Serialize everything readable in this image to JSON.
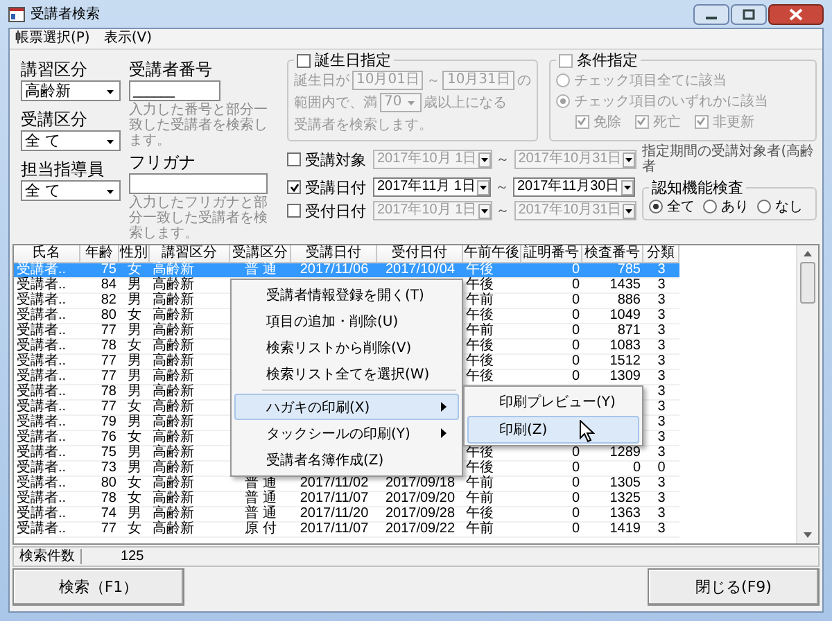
{
  "window": {
    "title": "受講者検索"
  },
  "menu": [
    "帳票選択(P)",
    "表示(V)"
  ],
  "selects": [
    {
      "label": "講習区分",
      "value": "高齢新"
    },
    {
      "label": "受講区分",
      "value": "全 て"
    },
    {
      "label": "担当指導員",
      "value": "全 て"
    }
  ],
  "text_searches": [
    {
      "label": "受講者番号",
      "value": "______",
      "hint": "入力した番号と部分一致した受講者を検索します。"
    },
    {
      "label": "フリガナ",
      "hint": "入力したフリガナと部分一致した受講者を検索します。"
    }
  ],
  "birthday": {
    "label": "誕生日指定",
    "checked": false,
    "text_before": "誕生日が",
    "from": "10月01日",
    "separator": "～",
    "to": "10月31日",
    "text_after": "の",
    "range_text": "範囲内で、満",
    "age": "70",
    "age_suffix": "歳以上になる",
    "closing_text": "受講者を検索します。"
  },
  "conditions": {
    "label": "条件指定",
    "checked": false,
    "options": [
      {
        "label": "チェック項目全てに該当",
        "selected": false
      },
      {
        "label": "チェック項目のいずれかに該当",
        "selected": true
      }
    ],
    "flags": [
      {
        "label": "免除",
        "checked": true
      },
      {
        "label": "死亡",
        "checked": true
      },
      {
        "label": "非更新",
        "checked": true
      }
    ]
  },
  "date_filters": [
    {
      "label": "受講対象",
      "checked": false,
      "from": "2017年10月 1日",
      "separator": "～",
      "to": "2017年10月31日",
      "note": "指定期間の受講対象者(高齢者"
    },
    {
      "label": "受講日付",
      "checked": true,
      "from": "2017年11月 1日",
      "separator": "～",
      "to": "2017年11月30日"
    },
    {
      "label": "受付日付",
      "checked": false,
      "from": "2017年10月 1日",
      "separator": "～",
      "to": "2017年10月31日"
    }
  ],
  "cognitive": {
    "label": "認知機能検査",
    "options": [
      {
        "label": "全て",
        "selected": true
      },
      {
        "label": "あり",
        "selected": false
      },
      {
        "label": "なし",
        "selected": false
      }
    ]
  },
  "table": {
    "columns": [
      "氏名",
      "年齢",
      "性別",
      "講習区分",
      "受講区分",
      "受講日付",
      "受付日付",
      "午前午後",
      "証明番号",
      "検査番号",
      "分類"
    ],
    "rows": [
      {
        "selected": true,
        "cells": [
          "受講者..",
          "75",
          "女",
          "高齢新",
          "普 通",
          "2017/11/06",
          "2017/10/04",
          "午後",
          "0",
          "785",
          "3"
        ]
      },
      {
        "selected": false,
        "cells": [
          "受講者..",
          "84",
          "男",
          "高齢新",
          null,
          null,
          null,
          "午後",
          "0",
          "1435",
          "3"
        ]
      },
      {
        "selected": false,
        "cells": [
          "受講者..",
          "82",
          "男",
          "高齢新",
          null,
          null,
          null,
          "午前",
          "0",
          "886",
          "3"
        ]
      },
      {
        "selected": false,
        "cells": [
          "受講者..",
          "80",
          "女",
          "高齢新",
          null,
          null,
          null,
          "午後",
          "0",
          "1049",
          "3"
        ]
      },
      {
        "selected": false,
        "cells": [
          "受講者..",
          "77",
          "男",
          "高齢新",
          null,
          null,
          null,
          "午前",
          "0",
          "871",
          "3"
        ]
      },
      {
        "selected": false,
        "cells": [
          "受講者..",
          "78",
          "女",
          "高齢新",
          null,
          null,
          null,
          "午後",
          "0",
          "1083",
          "3"
        ]
      },
      {
        "selected": false,
        "cells": [
          "受講者..",
          "77",
          "男",
          "高齢新",
          null,
          null,
          null,
          "午後",
          "0",
          "1512",
          "3"
        ]
      },
      {
        "selected": false,
        "cells": [
          "受講者..",
          "77",
          "男",
          "高齢新",
          null,
          null,
          null,
          "午後",
          "0",
          "1309",
          "3"
        ]
      },
      {
        "selected": false,
        "cells": [
          "受講者..",
          "78",
          "男",
          "高齢新",
          null,
          null,
          null,
          null,
          null,
          null,
          "3"
        ]
      },
      {
        "selected": false,
        "cells": [
          "受講者..",
          "77",
          "女",
          "高齢新",
          null,
          null,
          null,
          null,
          null,
          null,
          "3"
        ]
      },
      {
        "selected": false,
        "cells": [
          "受講者..",
          "79",
          "男",
          "高齢新",
          null,
          null,
          null,
          null,
          null,
          null,
          "3"
        ]
      },
      {
        "selected": false,
        "cells": [
          "受講者..",
          "76",
          "女",
          "高齢新",
          null,
          null,
          null,
          null,
          null,
          null,
          "3"
        ]
      },
      {
        "selected": false,
        "cells": [
          "受講者..",
          "75",
          "男",
          "高齢新",
          null,
          null,
          null,
          "午後",
          "0",
          "1289",
          "3"
        ]
      },
      {
        "selected": false,
        "cells": [
          "受講者..",
          "73",
          "男",
          "高齢新",
          null,
          null,
          null,
          "午後",
          "0",
          "0",
          "0"
        ]
      },
      {
        "selected": false,
        "cells": [
          "受講者..",
          "80",
          "女",
          "高齢新",
          "普 通",
          "2017/11/02",
          "2017/09/18",
          "午前",
          "0",
          "1305",
          "3"
        ]
      },
      {
        "selected": false,
        "cells": [
          "受講者..",
          "78",
          "女",
          "高齢新",
          "普 通",
          "2017/11/07",
          "2017/09/20",
          "午前",
          "0",
          "1325",
          "3"
        ]
      },
      {
        "selected": false,
        "cells": [
          "受講者..",
          "74",
          "男",
          "高齢新",
          "普 通",
          "2017/11/20",
          "2017/09/28",
          "午後",
          "0",
          "1363",
          "3"
        ]
      },
      {
        "selected": false,
        "cells": [
          "受講者..",
          "77",
          "女",
          "高齢新",
          "原 付",
          "2017/11/07",
          "2017/09/22",
          "午前",
          "0",
          "1419",
          "3"
        ]
      }
    ]
  },
  "context_menu": {
    "items": [
      {
        "kind": "item",
        "label": "受講者情報登録を開く(T)",
        "highlighted": false,
        "has_submenu": false
      },
      {
        "kind": "item",
        "label": "項目の追加・削除(U)",
        "highlighted": false,
        "has_submenu": false
      },
      {
        "kind": "item",
        "label": "検索リストから削除(V)",
        "highlighted": false,
        "has_submenu": false
      },
      {
        "kind": "item",
        "label": "検索リスト全てを選択(W)",
        "highlighted": false,
        "has_submenu": false
      },
      {
        "kind": "separator"
      },
      {
        "kind": "item",
        "label": "ハガキの印刷(X)",
        "highlighted": true,
        "has_submenu": true
      },
      {
        "kind": "item",
        "label": "タックシールの印刷(Y)",
        "highlighted": false,
        "has_submenu": true
      },
      {
        "kind": "item",
        "label": "受講者名簿作成(Z)",
        "highlighted": false,
        "has_submenu": false
      }
    ]
  },
  "submenu": {
    "items": [
      {
        "label": "印刷プレビュー(Y)",
        "highlighted": false
      },
      {
        "label": "印刷(Z)",
        "highlighted": true
      }
    ]
  },
  "status": {
    "label": "検索件数",
    "value": "125"
  },
  "buttons": [
    "検索（F1）",
    "閉じる(F9)"
  ]
}
